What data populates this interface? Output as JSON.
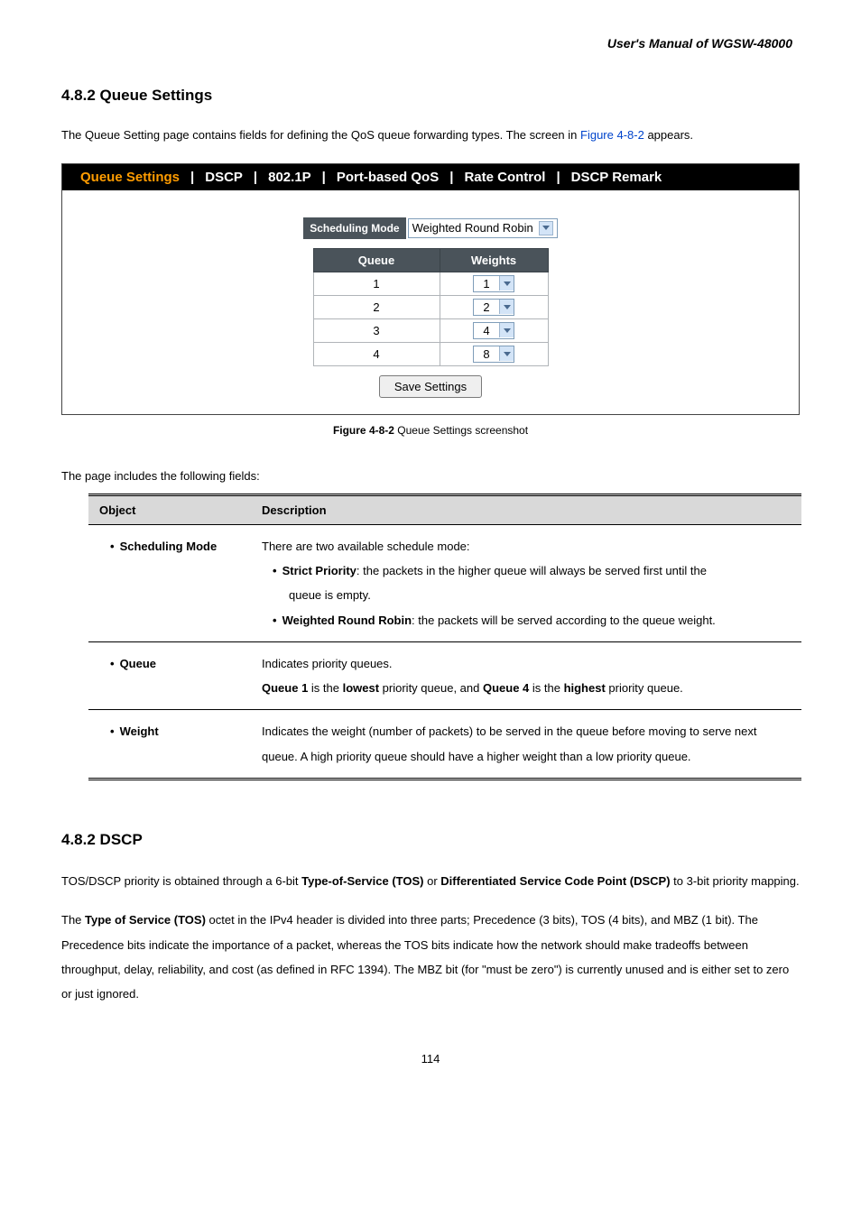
{
  "manual_title": "User's Manual of WGSW-48000",
  "section1": {
    "number": "4.8.2",
    "title": "Queue Settings",
    "intro_pre": "The Queue Setting page contains fields for defining the QoS queue forwarding types. The screen in ",
    "intro_link": "Figure 4-8-2",
    "intro_post": " appears."
  },
  "tabs": {
    "queue_settings": "Queue Settings",
    "dscp": "DSCP",
    "p8021": "802.1P",
    "portqos": "Port-based QoS",
    "rate": "Rate Control",
    "dscp_remark": "DSCP Remark"
  },
  "ui": {
    "sched_label": "Scheduling Mode",
    "sched_value": "Weighted Round Robin",
    "th_queue": "Queue",
    "th_weights": "Weights",
    "rows": [
      {
        "q": "1",
        "w": "1"
      },
      {
        "q": "2",
        "w": "2"
      },
      {
        "q": "3",
        "w": "4"
      },
      {
        "q": "4",
        "w": "8"
      }
    ],
    "save": "Save Settings"
  },
  "figure": {
    "label": "Figure 4-8-2",
    "caption": " Queue Settings screenshot"
  },
  "fields_intro": "The page includes the following fields:",
  "desc": {
    "th_object": "Object",
    "th_desc": "Description",
    "r1_obj": "Scheduling Mode",
    "r1_l1": "There are two available schedule mode:",
    "r1_sp_b": "Strict Priority",
    "r1_sp_t": ": the packets in the higher queue will always be served first until the",
    "r1_sp_t2": "queue is empty.",
    "r1_wrr_b": "Weighted Round Robin",
    "r1_wrr_t": ": the packets will be served according to the queue weight.",
    "r2_obj": "Queue",
    "r2_l1": "Indicates priority queues.",
    "r2_q1": "Queue 1",
    "r2_m1": " is the ",
    "r2_low": "lowest",
    "r2_m2": " priority queue, and ",
    "r2_q4": "Queue 4",
    "r2_m3": " is the ",
    "r2_high": "highest",
    "r2_m4": " priority queue.",
    "r3_obj": "Weight",
    "r3_t": "Indicates the weight (number of packets) to be served in the queue before moving to serve next queue. A high priority queue should have a higher weight than a low priority queue."
  },
  "section2": {
    "number": "4.8.2",
    "title": "DSCP",
    "p1_a": "TOS/DSCP priority is obtained through a 6-bit ",
    "p1_b1": "Type-of-Service (TOS)",
    "p1_c": " or ",
    "p1_b2": "Differentiated Service Code Point (DSCP)",
    "p1_d": " to 3-bit priority mapping.",
    "p2_a": "The ",
    "p2_b": "Type of Service (TOS)",
    "p2_c": " octet in the IPv4 header is divided into three parts; Precedence (3 bits), TOS (4 bits), and MBZ (1 bit). The Precedence bits indicate the importance of a packet, whereas the TOS bits indicate how the network should make tradeoffs between throughput, delay, reliability, and cost (as defined in RFC 1394). The MBZ bit (for \"must be zero\") is currently unused and is either set to zero or just ignored."
  },
  "page_number": "114"
}
